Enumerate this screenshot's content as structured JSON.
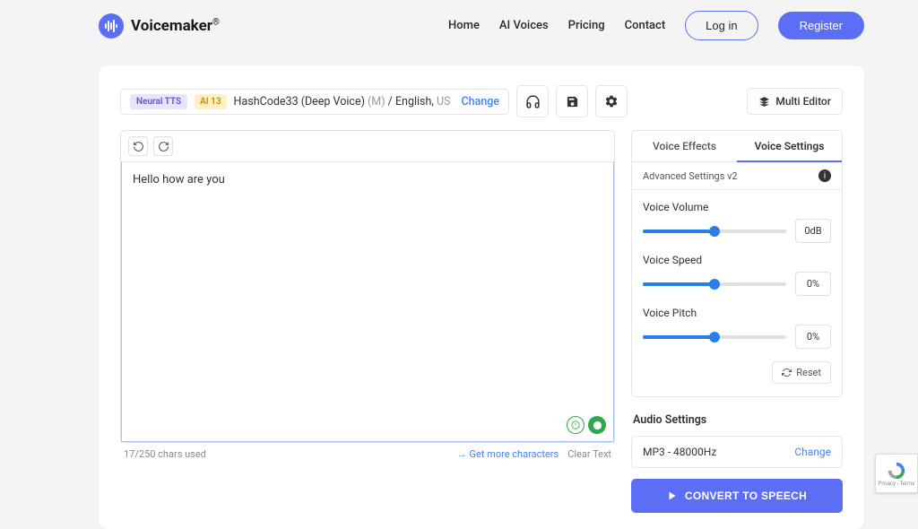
{
  "brand": {
    "name": "Voicemaker"
  },
  "nav": {
    "items": [
      "Home",
      "AI Voices",
      "Pricing",
      "Contact"
    ],
    "login": "Log in",
    "register": "Register"
  },
  "voice_bar": {
    "badge_neural": "Neural TTS",
    "badge_ai": "AI 13",
    "voice_name": "HashCode33 (Deep Voice) ",
    "voice_meta": "(M)",
    "voice_sep": " / ",
    "language": "English, ",
    "country": "US",
    "change": "Change",
    "multi_editor": "Multi Editor"
  },
  "editor": {
    "text": "Hello how are you",
    "char_count": "17/250 chars used",
    "more_chars": "Get more characters",
    "clear": "Clear Text"
  },
  "settings": {
    "tabs": {
      "effects": "Voice Effects",
      "voice": "Voice Settings"
    },
    "advanced": "Advanced Settings v2",
    "sliders": [
      {
        "label": "Voice Volume",
        "value": "0dB"
      },
      {
        "label": "Voice Speed",
        "value": "0%"
      },
      {
        "label": "Voice Pitch",
        "value": "0%"
      }
    ],
    "reset": "Reset"
  },
  "audio": {
    "label": "Audio Settings",
    "format": "MP3 - 48000Hz",
    "change": "Change",
    "convert": "CONVERT TO SPEECH"
  },
  "recaptcha": {
    "line1": "Privacy",
    "line2": "Terms"
  }
}
